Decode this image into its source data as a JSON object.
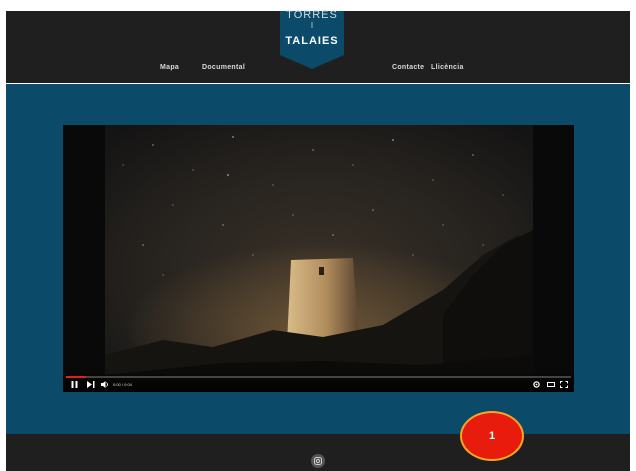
{
  "header": {
    "nav_left": [
      "Mapa",
      "Documental"
    ],
    "nav_right": [
      "Contacte",
      "Llicència"
    ],
    "logo": {
      "line1": "TORRES",
      "line2": "I",
      "line3": "TALAIES"
    }
  },
  "video": {
    "time": "0:00 / 0:04",
    "progress": 0.04,
    "icons": [
      "pause-icon",
      "skip-next-icon",
      "volume-icon",
      "settings-icon",
      "theater-icon",
      "fullscreen-icon"
    ]
  },
  "footer": {
    "social_icon": "instagram-icon"
  },
  "annotation": {
    "label": "1"
  },
  "colors": {
    "header_bg": "#1f1f1f",
    "main_bg": "#0b4a68",
    "logo_bg": "#0b4a68",
    "progress": "#e02020",
    "badge": "#e81c0c",
    "badge_border": "#f5a623"
  }
}
